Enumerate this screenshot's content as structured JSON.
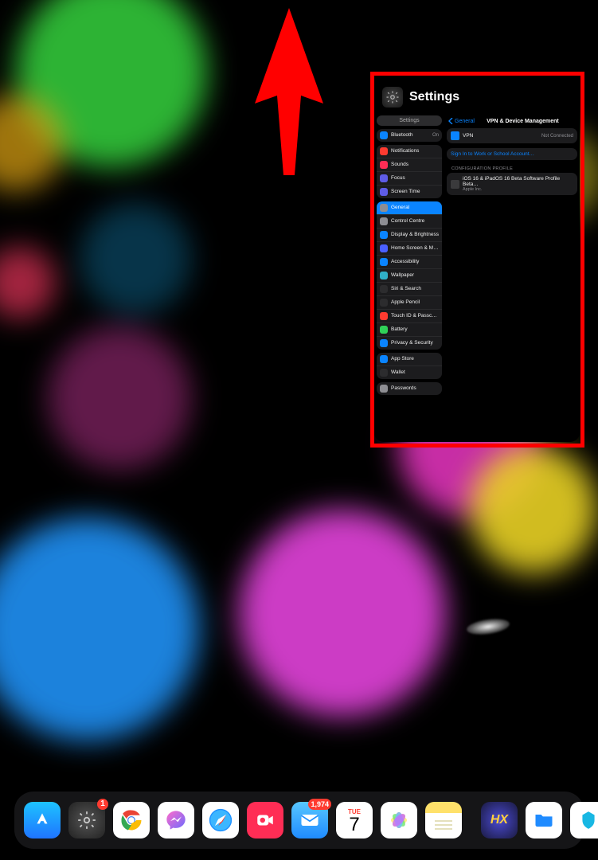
{
  "app": {
    "title": "Settings",
    "sidebar_search_label": "Settings"
  },
  "sidebar": {
    "group1": [
      {
        "label": "Bluetooth",
        "trail": "On",
        "icon_bg": "#0a84ff"
      }
    ],
    "group2": [
      {
        "label": "Notifications",
        "icon_bg": "#ff3b30"
      },
      {
        "label": "Sounds",
        "icon_bg": "#ff2d55"
      },
      {
        "label": "Focus",
        "icon_bg": "#5e5ce6"
      },
      {
        "label": "Screen Time",
        "icon_bg": "#5e5ce6"
      }
    ],
    "group3": [
      {
        "label": "General",
        "icon_bg": "#8e8e93",
        "selected": true
      },
      {
        "label": "Control Centre",
        "icon_bg": "#8e8e93"
      },
      {
        "label": "Display & Brightness",
        "icon_bg": "#0a84ff"
      },
      {
        "label": "Home Screen & Multitasking",
        "icon_bg": "#4a60ff"
      },
      {
        "label": "Accessibility",
        "icon_bg": "#0a84ff"
      },
      {
        "label": "Wallpaper",
        "icon_bg": "#30b0c7"
      },
      {
        "label": "Siri & Search",
        "icon_bg": "#2c2c2e"
      },
      {
        "label": "Apple Pencil",
        "icon_bg": "#2c2c2e"
      },
      {
        "label": "Touch ID & Passcode",
        "icon_bg": "#ff3b30"
      },
      {
        "label": "Battery",
        "icon_bg": "#30d158"
      },
      {
        "label": "Privacy & Security",
        "icon_bg": "#0a84ff"
      }
    ],
    "group4": [
      {
        "label": "App Store",
        "icon_bg": "#0a84ff"
      },
      {
        "label": "Wallet",
        "icon_bg": "#2c2c2e"
      }
    ],
    "group5": [
      {
        "label": "Passwords",
        "icon_bg": "#8e8e93"
      }
    ]
  },
  "detail": {
    "back_label": "General",
    "title": "VPN & Device Management",
    "vpn": {
      "label": "VPN",
      "status": "Not Connected",
      "icon_bg": "#0a84ff"
    },
    "signin_label": "Sign In to Work or School Account…",
    "section_label": "CONFIGURATION PROFILE",
    "profile": {
      "label": "iOS 16 & iPadOS 16 Beta Software Profile Beta…",
      "sub": "Apple Inc."
    }
  },
  "dock": {
    "apps": [
      {
        "name": "app-store",
        "bg": "#1f8bff",
        "badge": ""
      },
      {
        "name": "settings",
        "bg": "#2b2b2d",
        "badge": "1"
      },
      {
        "name": "chrome",
        "bg": "#ffffff",
        "badge": ""
      },
      {
        "name": "messenger",
        "bg": "#ffffff",
        "badge": ""
      },
      {
        "name": "safari",
        "bg": "#ffffff",
        "badge": ""
      },
      {
        "name": "screen-rec",
        "bg": "#ff2d55",
        "badge": ""
      },
      {
        "name": "mail",
        "bg": "#ffffff",
        "badge": "1,974"
      },
      {
        "name": "calendar",
        "bg": "#ffffff",
        "badge": "",
        "cal_weekday": "TUE",
        "cal_day": "7"
      },
      {
        "name": "photos",
        "bg": "#ffffff",
        "badge": ""
      },
      {
        "name": "notes",
        "bg": "#ffe16a",
        "badge": ""
      }
    ],
    "recent": [
      {
        "name": "hx",
        "bg": "#25235a"
      },
      {
        "name": "files",
        "bg": "#ffffff"
      },
      {
        "name": "app-blue",
        "bg": "#ffffff"
      },
      {
        "name": "app-library",
        "bg": "#2b2b2d"
      }
    ]
  }
}
